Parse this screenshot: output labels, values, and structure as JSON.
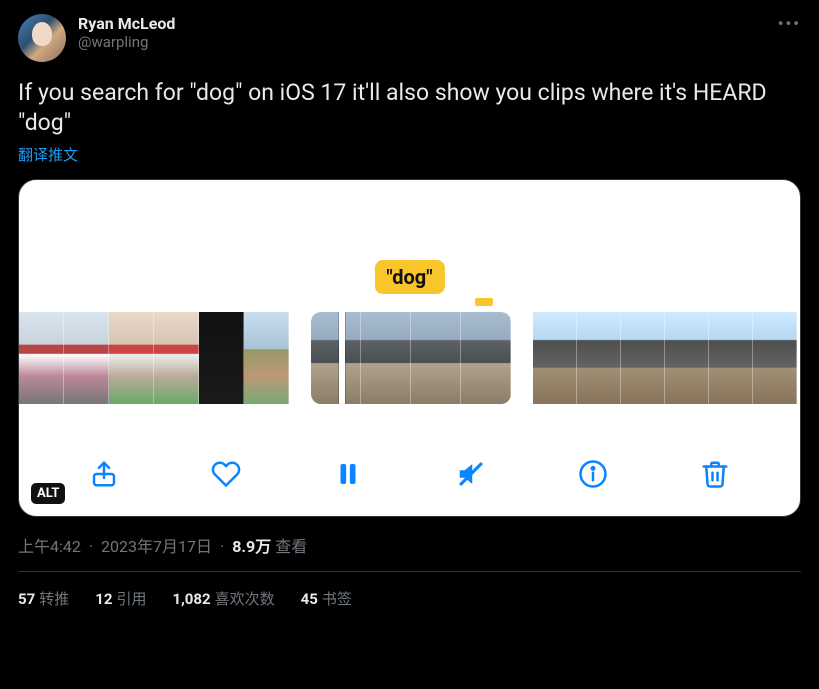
{
  "author": {
    "display_name": "Ryan McLeod",
    "handle": "@warpling"
  },
  "tweet": {
    "text": "If you search for \"dog\" on iOS 17 it'll also show you clips where it's HEARD \"dog\"",
    "translate_label": "翻译推文"
  },
  "media": {
    "dog_label": "\"dog\"",
    "alt_badge": "ALT"
  },
  "meta": {
    "time": "上午4:42",
    "date": "2023年7月17日",
    "views_count": "8.9万",
    "views_label": "查看"
  },
  "stats": {
    "retweets": {
      "count": "57",
      "label": "转推"
    },
    "quotes": {
      "count": "12",
      "label": "引用"
    },
    "likes": {
      "count": "1,082",
      "label": "喜欢次数"
    },
    "bookmarks": {
      "count": "45",
      "label": "书签"
    }
  }
}
